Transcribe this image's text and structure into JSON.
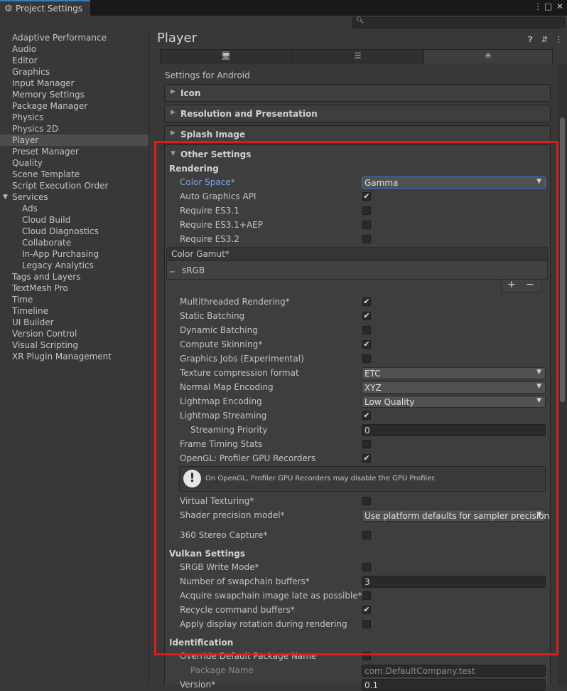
{
  "window": {
    "tab_title": "Project Settings",
    "menu_glyph": "⋮",
    "maximize_glyph": "□",
    "close_glyph": "✕"
  },
  "search": {
    "placeholder": "",
    "icon": "magnifier-icon"
  },
  "sidebar": {
    "items": [
      {
        "label": "Adaptive Performance"
      },
      {
        "label": "Audio"
      },
      {
        "label": "Editor"
      },
      {
        "label": "Graphics"
      },
      {
        "label": "Input Manager"
      },
      {
        "label": "Memory Settings"
      },
      {
        "label": "Package Manager"
      },
      {
        "label": "Physics"
      },
      {
        "label": "Physics 2D"
      },
      {
        "label": "Player"
      },
      {
        "label": "Preset Manager"
      },
      {
        "label": "Quality"
      },
      {
        "label": "Scene Template"
      },
      {
        "label": "Script Execution Order"
      },
      {
        "label": "Services"
      },
      {
        "label": "Ads"
      },
      {
        "label": "Cloud Build"
      },
      {
        "label": "Cloud Diagnostics"
      },
      {
        "label": "Collaborate"
      },
      {
        "label": "In-App Purchasing"
      },
      {
        "label": "Legacy Analytics"
      },
      {
        "label": "Tags and Layers"
      },
      {
        "label": "TextMesh Pro"
      },
      {
        "label": "Time"
      },
      {
        "label": "Timeline"
      },
      {
        "label": "UI Builder"
      },
      {
        "label": "Version Control"
      },
      {
        "label": "Visual Scripting"
      },
      {
        "label": "XR Plugin Management"
      }
    ],
    "selected": "Player"
  },
  "main": {
    "title": "Player",
    "header_icons": [
      "help-icon",
      "presets-icon",
      "menu-icon"
    ],
    "platform_tabs": [
      "desktop-icon",
      "server-icon",
      "android-icon"
    ],
    "selected_platform": "android",
    "settings_for": "Settings for Android",
    "sections": {
      "icon": "Icon",
      "resolution": "Resolution and Presentation",
      "splash": "Splash Image",
      "other": "Other Settings"
    },
    "rendering": {
      "header": "Rendering",
      "color_space_label": "Color Space*",
      "color_space_value": "Gamma",
      "auto_graphics_api": "Auto Graphics API",
      "require_es31": "Require ES3.1",
      "require_es31aep": "Require ES3.1+AEP",
      "require_es32": "Require ES3.2",
      "color_gamut_header": "Color Gamut*",
      "color_gamut_item": "sRGB",
      "multithreaded": "Multithreaded Rendering*",
      "static_batching": "Static Batching",
      "dynamic_batching": "Dynamic Batching",
      "compute_skinning": "Compute Skinning*",
      "graphics_jobs": "Graphics Jobs (Experimental)",
      "texture_compression_label": "Texture compression format",
      "texture_compression_value": "ETC",
      "normal_map_label": "Normal Map Encoding",
      "normal_map_value": "XYZ",
      "lightmap_encoding_label": "Lightmap Encoding",
      "lightmap_encoding_value": "Low Quality",
      "lightmap_streaming": "Lightmap Streaming",
      "streaming_priority_label": "Streaming Priority",
      "streaming_priority_value": "0",
      "frame_timing": "Frame Timing Stats",
      "opengl_profiler": "OpenGL: Profiler GPU Recorders",
      "help_text": "On OpenGL, Profiler GPU Recorders may disable the GPU Profiler.",
      "virtual_texturing": "Virtual Texturing*",
      "shader_precision_label": "Shader precision model*",
      "shader_precision_value": "Use platform defaults for sampler precision",
      "stereo_capture": "360 Stereo Capture*"
    },
    "vulkan": {
      "header": "Vulkan Settings",
      "srgb_write": "SRGB Write Mode*",
      "swapchain_label": "Number of swapchain buffers*",
      "swapchain_value": "3",
      "acquire_late": "Acquire swapchain image late as possible*",
      "recycle_buffers": "Recycle command buffers*",
      "display_rotation": "Apply display rotation during rendering"
    },
    "identification": {
      "header": "Identification",
      "override_package": "Override Default Package Name",
      "package_name_label": "Package Name",
      "package_name_value": "com.DefaultCompany.test",
      "version_label": "Version*",
      "version_value": "0.1"
    },
    "checkboxes": {
      "auto_graphics_api": true,
      "require_es31": false,
      "require_es31aep": false,
      "require_es32": false,
      "multithreaded": true,
      "static_batching": true,
      "dynamic_batching": false,
      "compute_skinning": true,
      "graphics_jobs": false,
      "lightmap_streaming": true,
      "frame_timing": false,
      "opengl_profiler": true,
      "virtual_texturing": false,
      "stereo_capture": false,
      "srgb_write": false,
      "acquire_late": false,
      "recycle_buffers": true,
      "display_rotation": false,
      "override_package": false
    },
    "check_glyph": "✔",
    "highlight_color": "#e01b1b",
    "accent_color": "#3a79bb"
  }
}
